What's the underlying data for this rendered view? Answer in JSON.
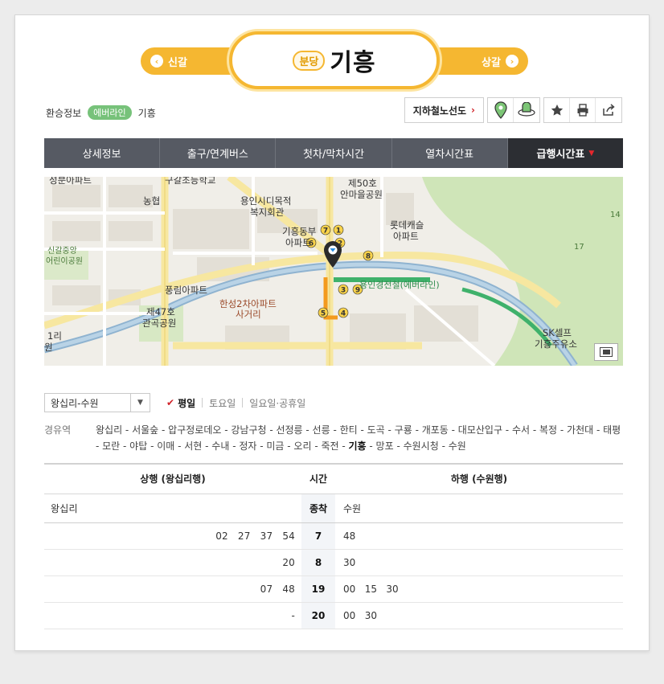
{
  "header": {
    "prev_label": "신갈",
    "next_label": "상갈",
    "line_badge": "분당",
    "station_name": "기흥"
  },
  "transfer": {
    "label": "환승정보",
    "line": "에버라인",
    "station": "기흥"
  },
  "tools": {
    "map_label": "지하철노선도",
    "icons": [
      "location-pin-icon",
      "train-icon",
      "star-icon",
      "print-icon",
      "share-icon"
    ]
  },
  "tabs": [
    {
      "label": "상세정보",
      "active": false
    },
    {
      "label": "출구/연계버스",
      "active": false
    },
    {
      "label": "첫차/막차시간",
      "active": false
    },
    {
      "label": "열차시간표",
      "active": false
    },
    {
      "label": "급행시간표",
      "active": true
    }
  ],
  "map": {
    "labels": [
      "성분아파트",
      "구갈초등학교",
      "농협",
      "용인시디목적",
      "복지회관",
      "제50호",
      "안마을공원",
      "기흥동부",
      "아파트",
      "롯데캐슬",
      "아파트",
      "신갈중앙",
      "어린이공원",
      "풍림아파트",
      "제47호",
      "관곡공원",
      "한성2차아파트",
      "사거리",
      "용인경전철(에버라인)",
      "SK셀프",
      "기흥주유소",
      "1리",
      "원",
      "14",
      "17"
    ]
  },
  "filter": {
    "direction": "왕십리-수원",
    "days": [
      "평일",
      "토요일",
      "일요일·공휴일"
    ],
    "active_day": "평일"
  },
  "via": {
    "label": "경유역",
    "stations_before": "왕십리 - 서울숲 - 압구정로데오 - 강남구청 - 선정릉 - 선릉 - 한티 - 도곡 - 구룡 - 개포동 - 대모산입구 - 수서 - 복정 - 가천대 - 태평 - 모란 - 야탑 - 이매 - 서현 - 수내 - 정자 - 미금 - 오리 - 죽전 - ",
    "current": "기흥",
    "stations_after": " - 망포 - 수원시청 - 수원"
  },
  "timetable": {
    "up_header": "상행 (왕십리행)",
    "time_header": "시간",
    "down_header": "하행 (수원행)",
    "up_dest": "왕십리",
    "time_dest": "종착",
    "down_dest": "수원",
    "rows": [
      {
        "up": "02   27   37   54",
        "hour": "7",
        "down": "48"
      },
      {
        "up": "20",
        "hour": "8",
        "down": "30"
      },
      {
        "up": "07   48",
        "hour": "19",
        "down": "00   15   30"
      },
      {
        "up": "-",
        "hour": "20",
        "down": "00   30"
      }
    ]
  }
}
